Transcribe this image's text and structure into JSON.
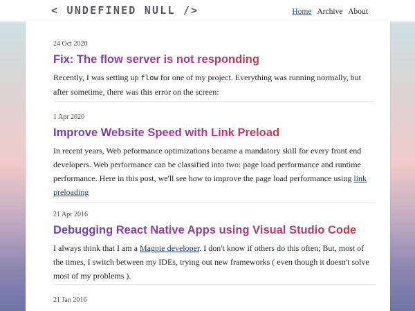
{
  "site": {
    "logo": "< UNDEFINED NULL />"
  },
  "nav": {
    "home": "Home",
    "archive": "Archive",
    "about": "About"
  },
  "posts": [
    {
      "date": "24 Oct 2020",
      "title": "Fix: The flow server is not responding",
      "excerpt_before": "Recently, I was setting up ",
      "excerpt_code": "flow",
      "excerpt_after": " for one of my project. Everything was running normally, but after sometime, there was this error on the screen:"
    },
    {
      "date": "1 Apr 2020",
      "title": "Improve Website Speed with Link Preload",
      "excerpt_before": "In recent years, Web peformance optimizations became a mandatory skill for every front end developers. Web performance can be classified into two: page load performance and runtime performance. Here in this post, we'll see how to improve the page load performance using ",
      "excerpt_link": "link preloading",
      "excerpt_after": ""
    },
    {
      "date": "21 Apr 2016",
      "title": "Debugging React Native Apps using Visual Studio Code",
      "excerpt_before": "I always think that I am a ",
      "excerpt_link": "Magpie developer",
      "excerpt_after": ". I don't know if others do this often; But, most of the times, I switch between my IDEs, trying out new frameworks ( even though it doesn't solve most of my problems )."
    },
    {
      "date": "21 Jan 2016"
    }
  ],
  "colors": {
    "title_gradient_start": "#6a3fb8",
    "title_gradient_end": "#c8384a",
    "logo": "#55575e"
  }
}
